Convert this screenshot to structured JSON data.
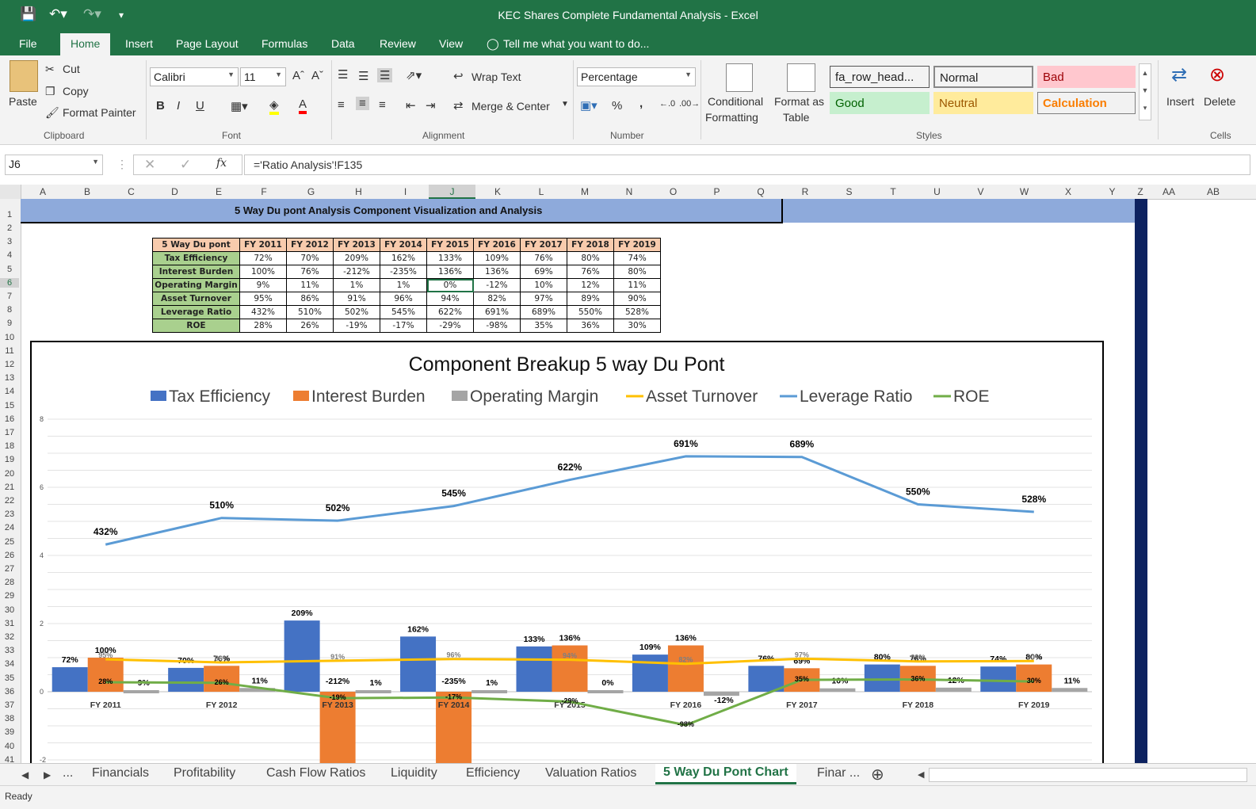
{
  "window": {
    "title": "KEC Shares Complete Fundamental Analysis - Excel"
  },
  "tabs": [
    "File",
    "Home",
    "Insert",
    "Page Layout",
    "Formulas",
    "Data",
    "Review",
    "View"
  ],
  "tell_me": "Tell me what you want to do...",
  "ribbon": {
    "clipboard": {
      "paste": "Paste",
      "cut": "Cut",
      "copy": "Copy",
      "format_painter": "Format Painter",
      "label": "Clipboard"
    },
    "font": {
      "name": "Calibri",
      "size": "11",
      "label": "Font",
      "bold": "B",
      "italic": "I",
      "underline": "U"
    },
    "alignment": {
      "wrap_text": "Wrap Text",
      "merge_center": "Merge & Center",
      "label": "Alignment"
    },
    "number": {
      "format": "Percentage",
      "label": "Number",
      "percent": "%",
      "comma": ","
    },
    "styles": {
      "conditional": "Conditional",
      "formatting": "Formatting",
      "format_as": "Format as",
      "table": "Table",
      "label": "Styles",
      "cells": [
        {
          "text": "fa_row_head...",
          "bg": "#ffffff",
          "fg": "#000000"
        },
        {
          "text": "Normal",
          "bg": "#ffffff",
          "fg": "#000000"
        },
        {
          "text": "Bad",
          "bg": "#ffc7ce",
          "fg": "#9c0006"
        },
        {
          "text": "Good",
          "bg": "#c6efce",
          "fg": "#006100"
        },
        {
          "text": "Neutral",
          "bg": "#ffeb9c",
          "fg": "#9c5700"
        },
        {
          "text": "Calculation",
          "bg": "#f2f2f2",
          "fg": "#fa7d00"
        }
      ]
    },
    "cells": {
      "insert": "Insert",
      "delete": "Delete",
      "label": "Cells"
    }
  },
  "formula_bar": {
    "name_box": "J6",
    "fx": "fx",
    "formula": "='Ratio Analysis'!F135"
  },
  "columns": [
    "A",
    "B",
    "C",
    "D",
    "E",
    "F",
    "G",
    "H",
    "I",
    "J",
    "K",
    "L",
    "M",
    "N",
    "O",
    "P",
    "Q",
    "R",
    "S",
    "T",
    "U",
    "V",
    "W",
    "X",
    "Y",
    "Z",
    "AA",
    "AB"
  ],
  "rows": [
    "1",
    "2",
    "3",
    "4",
    "5",
    "6",
    "7",
    "8",
    "9",
    "10",
    "11",
    "12",
    "13",
    "14",
    "15",
    "16",
    "17",
    "18",
    "19",
    "20",
    "21",
    "22",
    "23",
    "24",
    "25",
    "26",
    "27",
    "28",
    "29",
    "30",
    "31",
    "32",
    "33",
    "34",
    "35",
    "36",
    "37",
    "38",
    "39",
    "40",
    "41"
  ],
  "banner": "5 Way Du pont Analysis Component Visualization and Analysis",
  "table": {
    "header": [
      "5 Way Du pont",
      "FY 2011",
      "FY 2012",
      "FY 2013",
      "FY 2014",
      "FY 2015",
      "FY 2016",
      "FY 2017",
      "FY 2018",
      "FY 2019"
    ],
    "rows": [
      {
        "label": "Tax Efficiency",
        "values": [
          "72%",
          "70%",
          "209%",
          "162%",
          "133%",
          "109%",
          "76%",
          "80%",
          "74%"
        ]
      },
      {
        "label": "Interest Burden",
        "values": [
          "100%",
          "76%",
          "-212%",
          "-235%",
          "136%",
          "136%",
          "69%",
          "76%",
          "80%"
        ]
      },
      {
        "label": "Operating Margin",
        "values": [
          "9%",
          "11%",
          "1%",
          "1%",
          "0%",
          "-12%",
          "10%",
          "12%",
          "11%"
        ]
      },
      {
        "label": "Asset Turnover",
        "values": [
          "95%",
          "86%",
          "91%",
          "96%",
          "94%",
          "82%",
          "97%",
          "89%",
          "90%"
        ]
      },
      {
        "label": "Leverage Ratio",
        "values": [
          "432%",
          "510%",
          "502%",
          "545%",
          "622%",
          "691%",
          "689%",
          "550%",
          "528%"
        ]
      },
      {
        "label": "ROE",
        "values": [
          "28%",
          "26%",
          "-19%",
          "-17%",
          "-29%",
          "-98%",
          "35%",
          "36%",
          "30%"
        ]
      }
    ]
  },
  "chart_data": {
    "type": "bar",
    "title": "Component Breakup 5 way Du Pont",
    "categories": [
      "FY 2011",
      "FY 2012",
      "FY 2013",
      "FY 2014",
      "FY 2015",
      "FY 2016",
      "FY 2017",
      "FY 2018",
      "FY 2019"
    ],
    "ylim": [
      -2,
      8
    ],
    "yticks": [
      "-2",
      "0",
      "2",
      "4",
      "6",
      "8"
    ],
    "legend_position": "top",
    "bar_series": [
      {
        "name": "Tax Efficiency",
        "color": "#4472c4",
        "values": [
          0.72,
          0.7,
          2.09,
          1.62,
          1.33,
          1.09,
          0.76,
          0.8,
          0.74
        ],
        "labels": [
          "72%",
          "70%",
          "209%",
          "162%",
          "133%",
          "109%",
          "76%",
          "80%",
          "74%"
        ]
      },
      {
        "name": "Interest Burden",
        "color": "#ed7d31",
        "values": [
          1.0,
          0.76,
          -2.12,
          -2.35,
          1.36,
          1.36,
          0.69,
          0.76,
          0.8
        ],
        "labels": [
          "100%",
          "76%",
          "-212%",
          "-235%",
          "136%",
          "136%",
          "69%",
          "76%",
          "80%"
        ]
      },
      {
        "name": "Operating Margin",
        "color": "#a5a5a5",
        "values": [
          0.09,
          0.11,
          0.01,
          0.01,
          0.0,
          -0.12,
          0.1,
          0.12,
          0.11
        ],
        "labels": [
          "9%",
          "11%",
          "1%",
          "1%",
          "0%",
          "-12%",
          "10%",
          "12%",
          "11%"
        ]
      }
    ],
    "line_series": [
      {
        "name": "Asset Turnover",
        "color": "#ffc000",
        "values": [
          0.95,
          0.86,
          0.91,
          0.96,
          0.94,
          0.82,
          0.97,
          0.89,
          0.9
        ],
        "labels": [
          "95%",
          "86%",
          "91%",
          "96%",
          "94%",
          "82%",
          "97%",
          "89%",
          "90%"
        ]
      },
      {
        "name": "Leverage Ratio",
        "color": "#5b9bd5",
        "values": [
          4.32,
          5.1,
          5.02,
          5.45,
          6.22,
          6.91,
          6.89,
          5.5,
          5.28
        ],
        "labels": [
          "432%",
          "510%",
          "502%",
          "545%",
          "622%",
          "691%",
          "689%",
          "550%",
          "528%"
        ]
      },
      {
        "name": "ROE",
        "color": "#70ad47",
        "values": [
          0.28,
          0.26,
          -0.19,
          -0.17,
          -0.29,
          -0.98,
          0.35,
          0.36,
          0.3
        ],
        "labels": [
          "28%",
          "26%",
          "-19%",
          "-17%",
          "-29%",
          "-98%",
          "35%",
          "36%",
          "30%"
        ]
      }
    ]
  },
  "sheet_tabs": [
    "...",
    "Financials",
    "Profitability",
    "Cash Flow Ratios",
    "Liquidity",
    "Efficiency",
    "Valuation Ratios",
    "5 Way Du Pont Chart",
    "Finar ..."
  ],
  "active_sheet": "5 Way Du Pont Chart",
  "status": "Ready"
}
